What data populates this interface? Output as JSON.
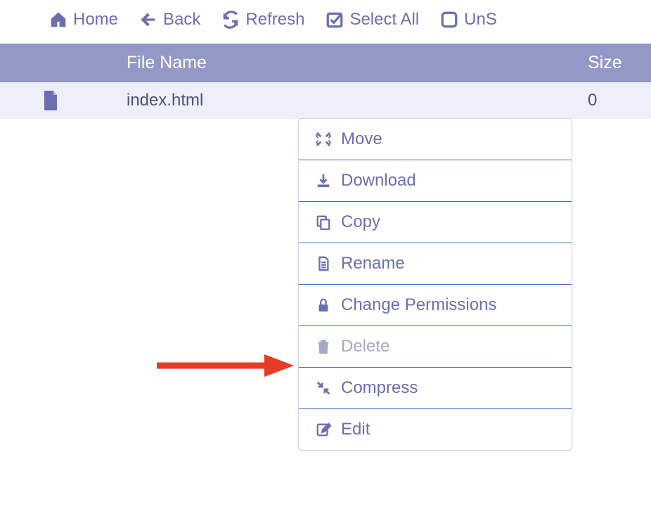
{
  "toolbar": {
    "home": "Home",
    "back": "Back",
    "refresh": "Refresh",
    "select_all": "Select All",
    "unselect": "UnS"
  },
  "table": {
    "header": {
      "name": "File Name",
      "size": "Size"
    },
    "rows": [
      {
        "name": "index.html",
        "size": "0"
      }
    ]
  },
  "context_menu": {
    "move": "Move",
    "download": "Download",
    "copy": "Copy",
    "rename": "Rename",
    "change_permissions": "Change Permissions",
    "delete": "Delete",
    "compress": "Compress",
    "edit": "Edit"
  }
}
